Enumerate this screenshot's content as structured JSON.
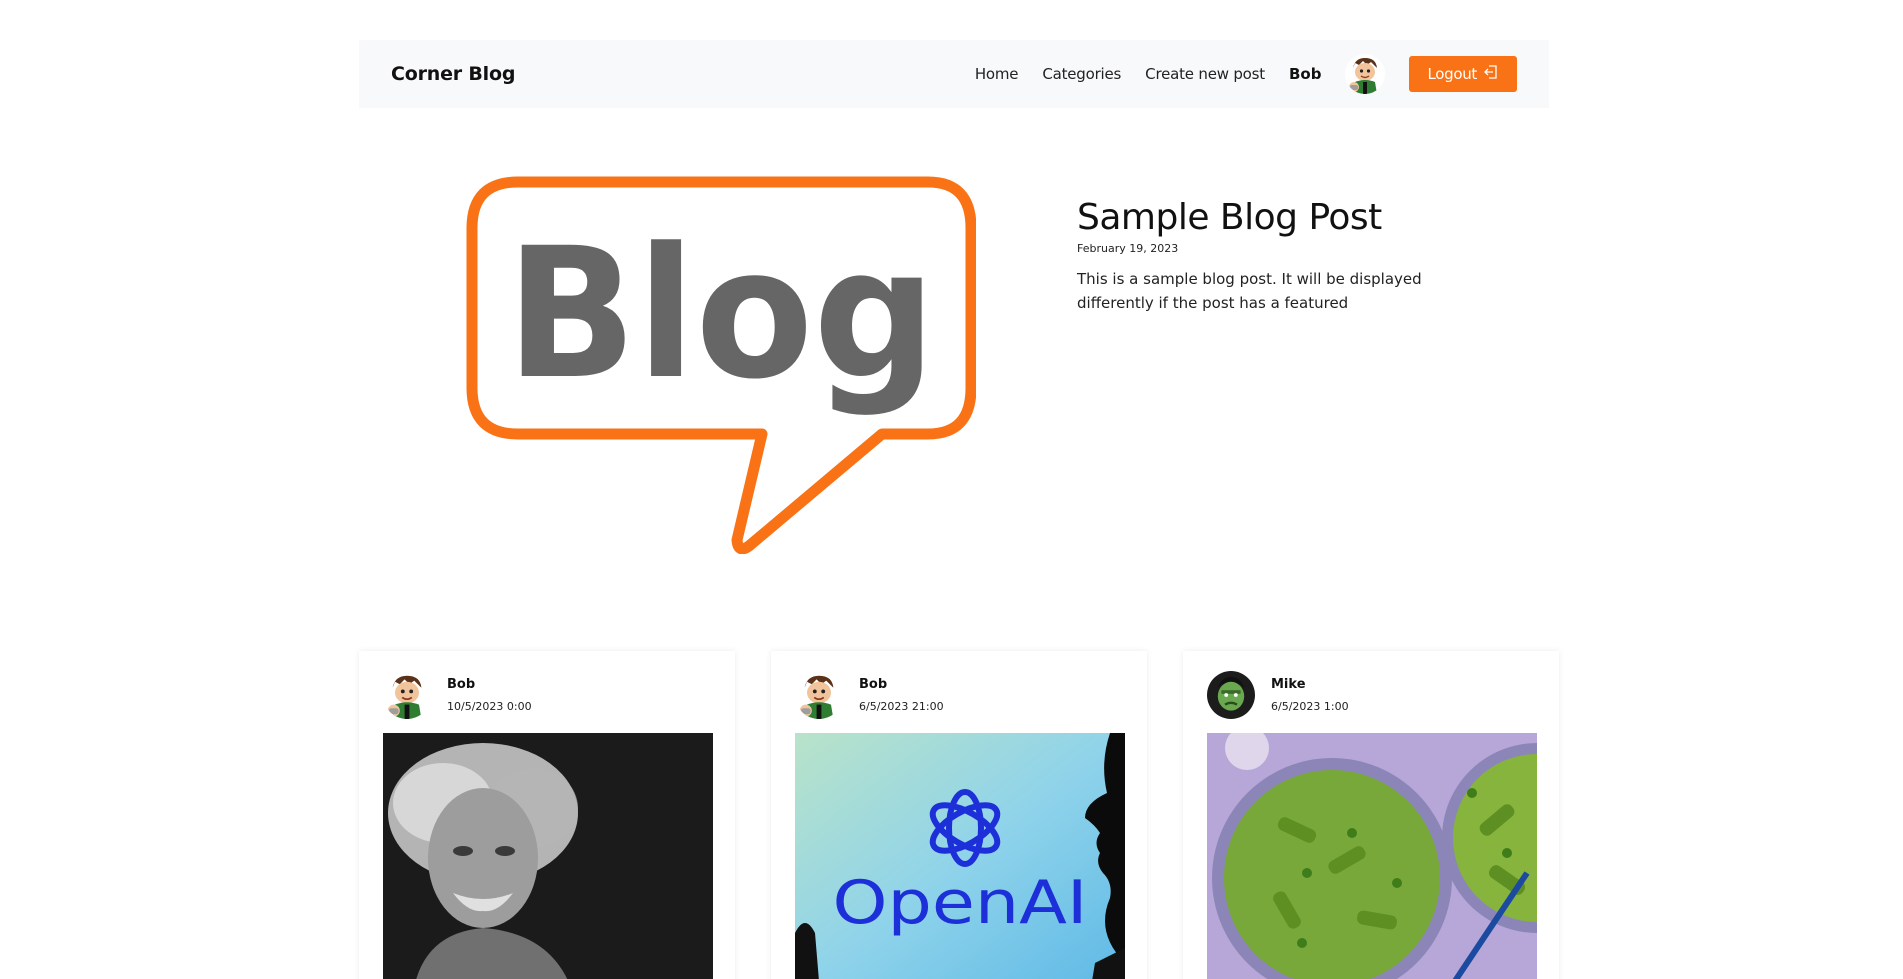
{
  "navbar": {
    "brand": "Corner Blog",
    "links": [
      "Home",
      "Categories",
      "Create new post"
    ],
    "user_name": "Bob",
    "logout_label": "Logout"
  },
  "featured": {
    "logo_text": "Blog",
    "title": "Sample Blog Post",
    "date": "February 19, 2023",
    "excerpt": "This is a sample blog post. It will be displayed differently if the post has a featured"
  },
  "posts": [
    {
      "author": "Bob",
      "date": "10/5/2023 0:00",
      "avatar": "cartoon-boy-avatar",
      "image": "einstein-portrait"
    },
    {
      "author": "Bob",
      "date": "6/5/2023 21:00",
      "avatar": "cartoon-boy-avatar",
      "image": "openai-logo-photo",
      "image_text": "OpenAI"
    },
    {
      "author": "Mike",
      "date": "6/5/2023 1:00",
      "avatar": "hulk-avatar",
      "image": "pesto-pasta-photo"
    }
  ],
  "colors": {
    "accent": "#f97316",
    "navbar_bg": "#f8f9fa",
    "logo_text": "#666666"
  }
}
